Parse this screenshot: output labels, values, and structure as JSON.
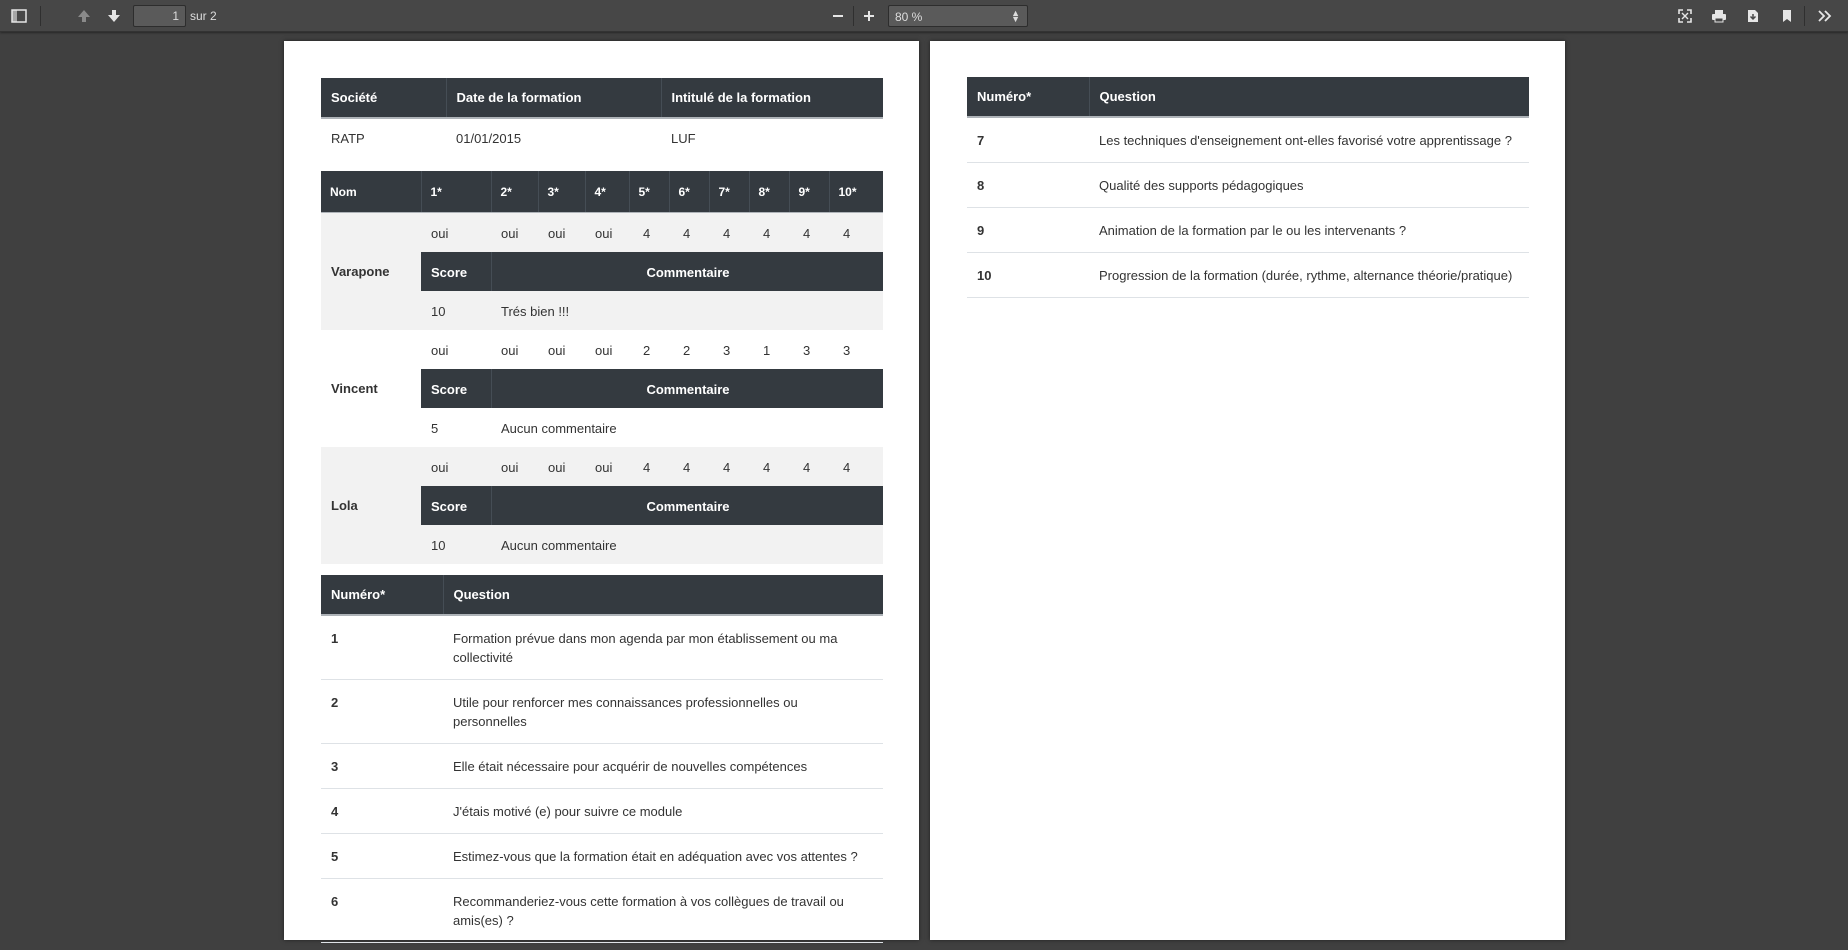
{
  "toolbar": {
    "page_current": "1",
    "page_count_label": "sur 2",
    "zoom_value": "80 %"
  },
  "info_table": {
    "headers": [
      "Société",
      "Date de la formation",
      "Intitulé de la formation"
    ],
    "row": [
      "RATP",
      "01/01/2015",
      "LUF"
    ]
  },
  "scores": {
    "headers": [
      "Nom",
      "1*",
      "2*",
      "3*",
      "4*",
      "5*",
      "6*",
      "7*",
      "8*",
      "9*",
      "10*"
    ],
    "score_label": "Score",
    "comment_label": "Commentaire",
    "people": [
      {
        "name": "Varapone",
        "answers": [
          "oui",
          "oui",
          "oui",
          "oui",
          "4",
          "4",
          "4",
          "4",
          "4",
          "4"
        ],
        "score": "10",
        "comment": "Trés bien !!!"
      },
      {
        "name": "Vincent",
        "answers": [
          "oui",
          "oui",
          "oui",
          "oui",
          "2",
          "2",
          "3",
          "1",
          "3",
          "3"
        ],
        "score": "5",
        "comment": "Aucun commentaire"
      },
      {
        "name": "Lola",
        "answers": [
          "oui",
          "oui",
          "oui",
          "oui",
          "4",
          "4",
          "4",
          "4",
          "4",
          "4"
        ],
        "score": "10",
        "comment": "Aucun commentaire"
      }
    ]
  },
  "questions": {
    "headers": [
      "Numéro*",
      "Question"
    ],
    "page1": [
      {
        "num": "1",
        "text": "Formation prévue dans mon agenda par mon établissement ou ma collectivité"
      },
      {
        "num": "2",
        "text": "Utile pour renforcer mes connaissances professionnelles ou personnelles"
      },
      {
        "num": "3",
        "text": "Elle était nécessaire pour acquérir de nouvelles compétences"
      },
      {
        "num": "4",
        "text": "J'étais motivé (e) pour suivre ce module"
      },
      {
        "num": "5",
        "text": "Estimez-vous que la formation était en adéquation avec vos attentes ?"
      },
      {
        "num": "6",
        "text": "Recommanderiez-vous cette formation à vos collègues de travail ou amis(es) ?"
      }
    ],
    "page2": [
      {
        "num": "7",
        "text": "Les techniques d'enseignement ont-elles favorisé votre apprentissage ?"
      },
      {
        "num": "8",
        "text": "Qualité des supports pédagogiques"
      },
      {
        "num": "9",
        "text": "Animation de la formation par le ou les intervenants ?"
      },
      {
        "num": "10",
        "text": "Progression de la formation (durée, rythme, alternance théorie/pratique)"
      }
    ]
  }
}
